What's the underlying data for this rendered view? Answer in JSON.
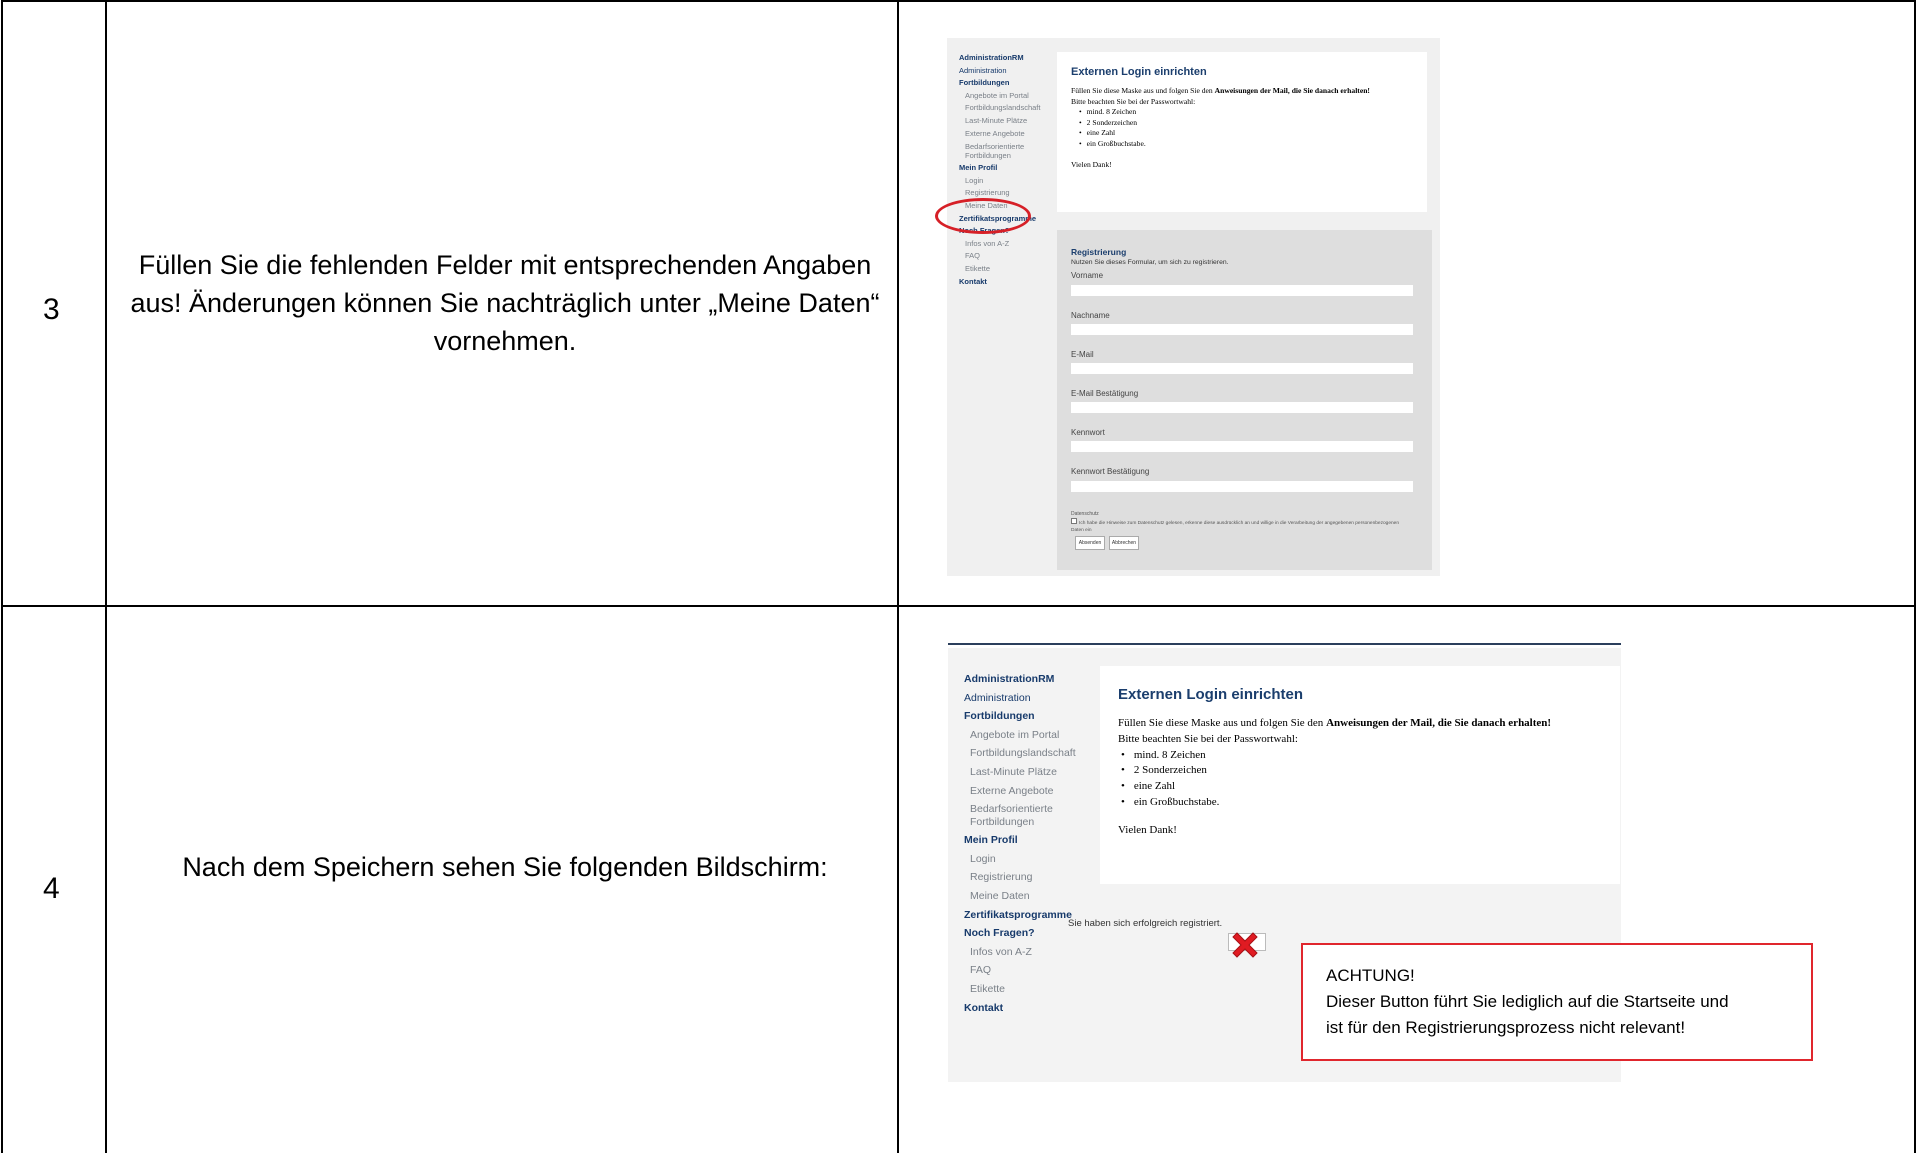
{
  "table": {
    "rows": [
      {
        "number": "3",
        "description": "Füllen Sie die fehlenden Felder mit entsprechenden Angaben aus! Änderungen können Sie nachträglich unter „Meine Daten“ vornehmen."
      },
      {
        "number": "4",
        "description": "Nach dem Speichern sehen Sie folgenden Bildschirm:"
      }
    ]
  },
  "nav": {
    "g1": "AdministrationRM",
    "g2": "Administration",
    "g3": "Fortbildungen",
    "l1": "Angebote im Portal",
    "l2": "Fortbildungslandschaft",
    "l3": "Last-Minute Plätze",
    "l4": "Externe Angebote",
    "l5": "Bedarfsorientierte Fortbildungen",
    "g4": "Mein Profil",
    "l6": "Login",
    "l7": "Registrierung",
    "l8": "Meine Daten",
    "g5": "Zertifikatsprogramme",
    "g6": "Noch Fragen?",
    "l9": "Infos von A-Z",
    "l10": "FAQ",
    "l11": "Etikette",
    "g7": "Kontakt"
  },
  "info_card": {
    "title": "Externen Login einrichten",
    "intro_start": "Füllen Sie diese Maske aus und folgen Sie den ",
    "intro_bold": "Anweisungen der Mail, die Sie danach erhalten!",
    "hint": "Bitte beachten Sie bei der Passwortwahl:",
    "rules": [
      "mind. 8 Zeichen",
      "2 Sonderzeichen",
      "eine Zahl",
      "ein Großbuchstabe."
    ],
    "thanks": "Vielen Dank!"
  },
  "registration_form": {
    "title": "Registrierung",
    "subtitle": "Nutzen Sie dieses Formular, um sich zu registrieren.",
    "fields": [
      "Vorname",
      "Nachname",
      "E-Mail",
      "E-Mail Bestätigung",
      "Kennwort",
      "Kennwort Bestätigung"
    ],
    "privacy_heading": "Datenschutz",
    "privacy_text": "Ich habe die Hinweise zum Datenschutz gelesen, erkenne diese ausdrücklich an und willige in die Verarbeitung der angegebenen personenbezogenen Daten ein",
    "submit_label": "Absenden",
    "cancel_label": "Abbrechen"
  },
  "success": {
    "message": "Sie haben sich erfolgreich registriert."
  },
  "callout": {
    "title": "ACHTUNG!",
    "line1": "Dieser Button führt Sie lediglich auf die Startseite und",
    "line2": "ist für den Registrierungsprozess nicht relevant!"
  },
  "colors": {
    "highlight_red": "#d62027",
    "nav_heading": "#173a6b",
    "nav_link": "#7a8088"
  }
}
